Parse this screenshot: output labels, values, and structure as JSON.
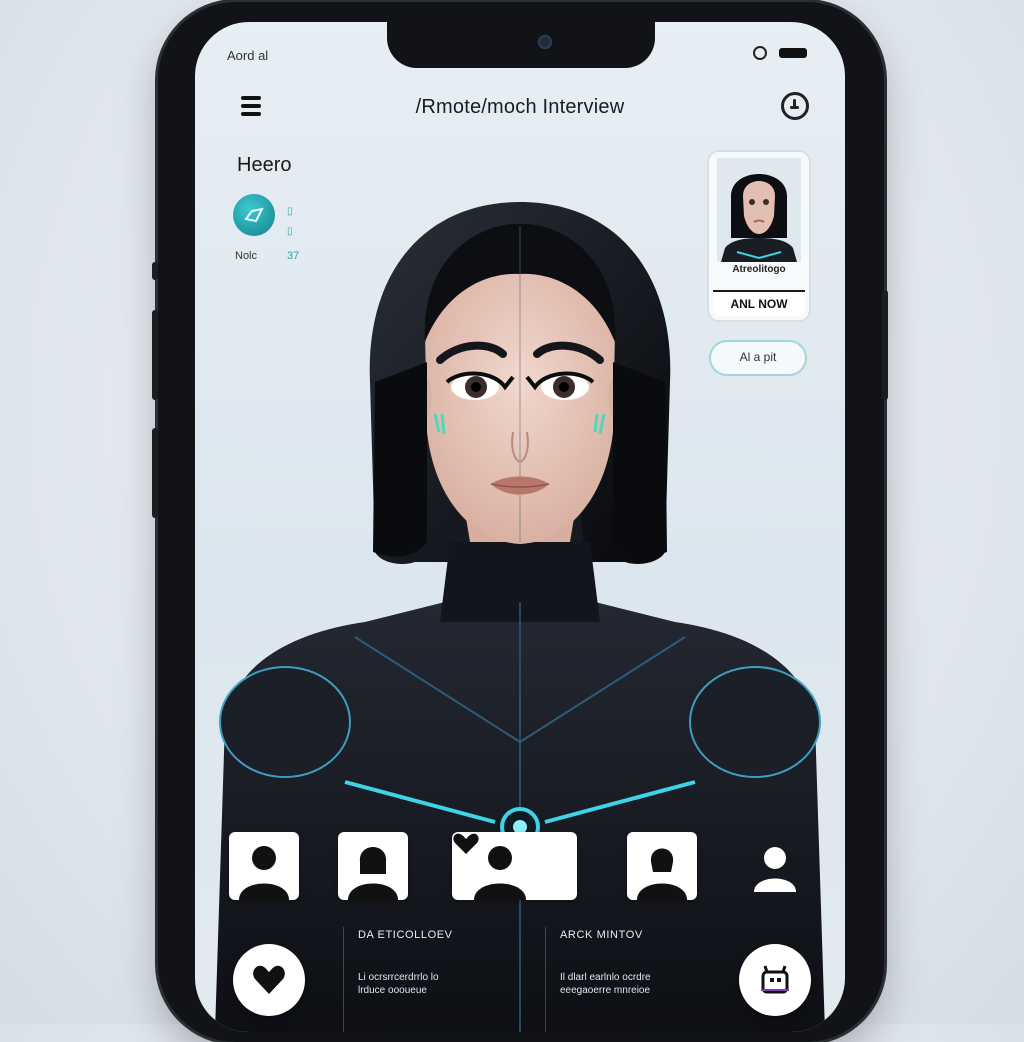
{
  "status_bar": {
    "carrier": "Aord al"
  },
  "header": {
    "title": "/Rmote/moch Interview"
  },
  "hero": {
    "label": "Heero",
    "caption": "Nolc",
    "caption_num": "37"
  },
  "preview": {
    "label": "Atreolitogo",
    "call_now": "ANL NOW"
  },
  "side_button": {
    "label": "Al a pit"
  },
  "info_left": {
    "title": "DA ETICOLLOEV",
    "text_line1": "Li ocrsrrcerdrrlo lo",
    "text_line2": "lrduce oooueue"
  },
  "info_right": {
    "title": "ARCK MINTOV",
    "text_line1": "Il dlarl earlnlo ocrdre",
    "text_line2": "eeegaoerre mnreioe"
  },
  "icons": [
    "menu-icon",
    "clock-icon",
    "hero-badge-icon",
    "heart-icon",
    "person-icon",
    "bot-icon"
  ],
  "colors": {
    "accent": "#2aa4ad",
    "suit": "#12151b",
    "glow": "#3fd3e6",
    "screen_bg": "#e3eaf0"
  }
}
